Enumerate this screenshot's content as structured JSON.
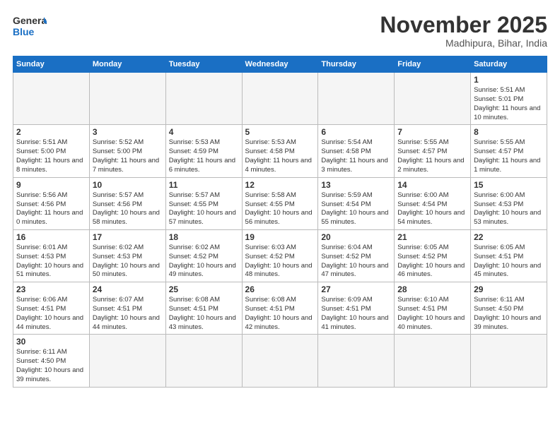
{
  "header": {
    "logo_general": "General",
    "logo_blue": "Blue",
    "month_title": "November 2025",
    "location": "Madhipura, Bihar, India"
  },
  "days_of_week": [
    "Sunday",
    "Monday",
    "Tuesday",
    "Wednesday",
    "Thursday",
    "Friday",
    "Saturday"
  ],
  "weeks": [
    [
      {
        "day": "",
        "info": ""
      },
      {
        "day": "",
        "info": ""
      },
      {
        "day": "",
        "info": ""
      },
      {
        "day": "",
        "info": ""
      },
      {
        "day": "",
        "info": ""
      },
      {
        "day": "",
        "info": ""
      },
      {
        "day": "1",
        "info": "Sunrise: 5:51 AM\nSunset: 5:01 PM\nDaylight: 11 hours and 10 minutes."
      }
    ],
    [
      {
        "day": "2",
        "info": "Sunrise: 5:51 AM\nSunset: 5:00 PM\nDaylight: 11 hours and 8 minutes."
      },
      {
        "day": "3",
        "info": "Sunrise: 5:52 AM\nSunset: 5:00 PM\nDaylight: 11 hours and 7 minutes."
      },
      {
        "day": "4",
        "info": "Sunrise: 5:53 AM\nSunset: 4:59 PM\nDaylight: 11 hours and 6 minutes."
      },
      {
        "day": "5",
        "info": "Sunrise: 5:53 AM\nSunset: 4:58 PM\nDaylight: 11 hours and 4 minutes."
      },
      {
        "day": "6",
        "info": "Sunrise: 5:54 AM\nSunset: 4:58 PM\nDaylight: 11 hours and 3 minutes."
      },
      {
        "day": "7",
        "info": "Sunrise: 5:55 AM\nSunset: 4:57 PM\nDaylight: 11 hours and 2 minutes."
      },
      {
        "day": "8",
        "info": "Sunrise: 5:55 AM\nSunset: 4:57 PM\nDaylight: 11 hours and 1 minute."
      }
    ],
    [
      {
        "day": "9",
        "info": "Sunrise: 5:56 AM\nSunset: 4:56 PM\nDaylight: 11 hours and 0 minutes."
      },
      {
        "day": "10",
        "info": "Sunrise: 5:57 AM\nSunset: 4:56 PM\nDaylight: 10 hours and 58 minutes."
      },
      {
        "day": "11",
        "info": "Sunrise: 5:57 AM\nSunset: 4:55 PM\nDaylight: 10 hours and 57 minutes."
      },
      {
        "day": "12",
        "info": "Sunrise: 5:58 AM\nSunset: 4:55 PM\nDaylight: 10 hours and 56 minutes."
      },
      {
        "day": "13",
        "info": "Sunrise: 5:59 AM\nSunset: 4:54 PM\nDaylight: 10 hours and 55 minutes."
      },
      {
        "day": "14",
        "info": "Sunrise: 6:00 AM\nSunset: 4:54 PM\nDaylight: 10 hours and 54 minutes."
      },
      {
        "day": "15",
        "info": "Sunrise: 6:00 AM\nSunset: 4:53 PM\nDaylight: 10 hours and 53 minutes."
      }
    ],
    [
      {
        "day": "16",
        "info": "Sunrise: 6:01 AM\nSunset: 4:53 PM\nDaylight: 10 hours and 51 minutes."
      },
      {
        "day": "17",
        "info": "Sunrise: 6:02 AM\nSunset: 4:53 PM\nDaylight: 10 hours and 50 minutes."
      },
      {
        "day": "18",
        "info": "Sunrise: 6:02 AM\nSunset: 4:52 PM\nDaylight: 10 hours and 49 minutes."
      },
      {
        "day": "19",
        "info": "Sunrise: 6:03 AM\nSunset: 4:52 PM\nDaylight: 10 hours and 48 minutes."
      },
      {
        "day": "20",
        "info": "Sunrise: 6:04 AM\nSunset: 4:52 PM\nDaylight: 10 hours and 47 minutes."
      },
      {
        "day": "21",
        "info": "Sunrise: 6:05 AM\nSunset: 4:52 PM\nDaylight: 10 hours and 46 minutes."
      },
      {
        "day": "22",
        "info": "Sunrise: 6:05 AM\nSunset: 4:51 PM\nDaylight: 10 hours and 45 minutes."
      }
    ],
    [
      {
        "day": "23",
        "info": "Sunrise: 6:06 AM\nSunset: 4:51 PM\nDaylight: 10 hours and 44 minutes."
      },
      {
        "day": "24",
        "info": "Sunrise: 6:07 AM\nSunset: 4:51 PM\nDaylight: 10 hours and 44 minutes."
      },
      {
        "day": "25",
        "info": "Sunrise: 6:08 AM\nSunset: 4:51 PM\nDaylight: 10 hours and 43 minutes."
      },
      {
        "day": "26",
        "info": "Sunrise: 6:08 AM\nSunset: 4:51 PM\nDaylight: 10 hours and 42 minutes."
      },
      {
        "day": "27",
        "info": "Sunrise: 6:09 AM\nSunset: 4:51 PM\nDaylight: 10 hours and 41 minutes."
      },
      {
        "day": "28",
        "info": "Sunrise: 6:10 AM\nSunset: 4:51 PM\nDaylight: 10 hours and 40 minutes."
      },
      {
        "day": "29",
        "info": "Sunrise: 6:11 AM\nSunset: 4:50 PM\nDaylight: 10 hours and 39 minutes."
      }
    ],
    [
      {
        "day": "30",
        "info": "Sunrise: 6:11 AM\nSunset: 4:50 PM\nDaylight: 10 hours and 39 minutes."
      },
      {
        "day": "",
        "info": ""
      },
      {
        "day": "",
        "info": ""
      },
      {
        "day": "",
        "info": ""
      },
      {
        "day": "",
        "info": ""
      },
      {
        "day": "",
        "info": ""
      },
      {
        "day": "",
        "info": ""
      }
    ]
  ]
}
